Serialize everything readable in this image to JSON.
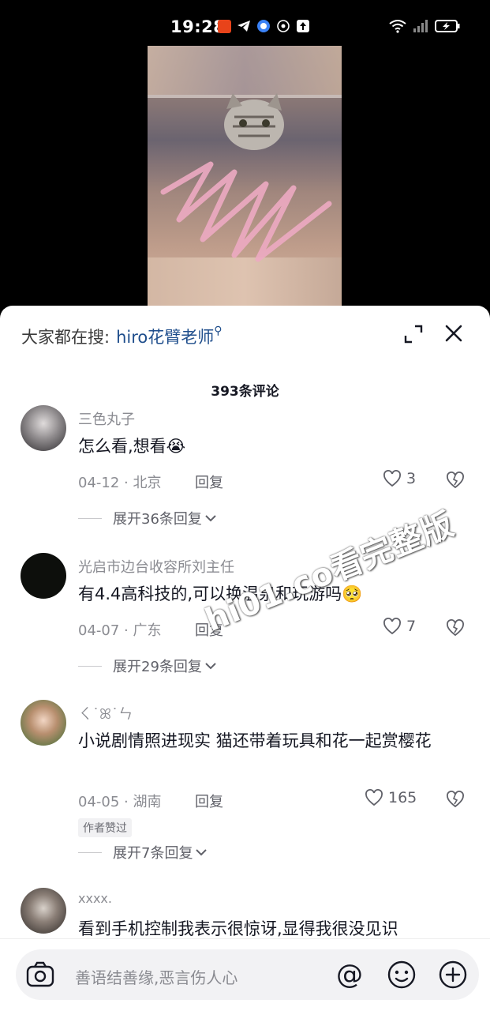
{
  "status_bar": {
    "time": "19:28",
    "left_icons": [
      "app-badge-icon",
      "telegram-icon",
      "browser-icon",
      "hotspot-icon",
      "upload-icon"
    ],
    "right_icons": [
      "wifi-icon",
      "signal-icon",
      "battery-charging-icon"
    ]
  },
  "search": {
    "prefix": "大家都在搜:",
    "query": "hiro花臂老师"
  },
  "comment_count": "393条评论",
  "comments": [
    {
      "user": "三色丸子",
      "text": "怎么看,想看😭",
      "date_location": "04-12 · 北京",
      "reply_label": "回复",
      "likes": "3",
      "expand_label": "展开36条回复"
    },
    {
      "user": "光启市边台收容所刘主任",
      "text": "有4.4高科技的,可以换温泉和玩游吗🥺",
      "date_location": "04-07 · 广东",
      "reply_label": "回复",
      "likes": "7",
      "expand_label": "展开29条回复"
    },
    {
      "user": "ㄑ˙ꕤ˙ㄣ",
      "text": "小说剧情照进现实 猫还带着玩具和花一起赏樱花",
      "date_location": "04-05 · 湖南",
      "reply_label": "回复",
      "likes": "165",
      "badge": "作者赞过",
      "expand_label": "展开7条回复"
    },
    {
      "user": "xxxx.",
      "text": "看到手机控制我表示很惊讶,显得我很没见识"
    }
  ],
  "input": {
    "placeholder": "善语结善缘,恶言伤人心",
    "at_label": "@"
  },
  "watermark": "hi01.co看完整版",
  "colors": {
    "link": "#1f4e8c",
    "secondary_text": "#8a8b91",
    "primary_text": "#161823"
  }
}
